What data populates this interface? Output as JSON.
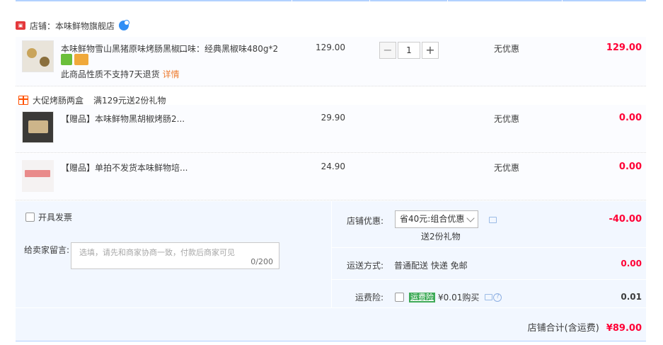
{
  "shop": {
    "name": "店铺：本味鲜物旗舰店",
    "icon": "store-badge-icon",
    "chat_icon": "wangwang-chat-icon"
  },
  "items": [
    {
      "title": "本味鲜物雪山黑猪原味烤肠黑椒...",
      "flavor": "口味：经典黑椒味480g*2",
      "price": "129.00",
      "quantity": "1",
      "discount": "无优惠",
      "total": "129.00",
      "return_note": "此商品性质不支持7天退货",
      "details_link": "详情"
    },
    {
      "title": "【赠品】本味鲜物黑胡椒烤肠2...",
      "price": "29.90",
      "discount": "无优惠",
      "total": "0.00"
    },
    {
      "title": "【赠品】单拍不发货本味鲜物培...",
      "price": "24.90",
      "discount": "无优惠",
      "total": "0.00"
    }
  ],
  "promo": {
    "name": "大促烤肠两盒",
    "description": "满129元送2份礼物"
  },
  "invoice": {
    "label": "开具发票",
    "checked": false
  },
  "message": {
    "label": "给卖家留言:",
    "placeholder": "选填，请先和商家协商一致，付款后商家可见",
    "counter": "0/200"
  },
  "shop_discount": {
    "label": "店铺优惠:",
    "selected": "省40元:组合优惠",
    "gift_note": "送2份礼物",
    "value": "-40.00"
  },
  "shipping": {
    "label": "运送方式:",
    "method": "普通配送 快递 免邮",
    "value": "0.00"
  },
  "insurance": {
    "label": "运费险:",
    "badge": "运费险",
    "price_text": "¥0.01购买",
    "value": "0.01",
    "checked": false
  },
  "summary": {
    "label": "店铺合计(含运费)",
    "amount": "¥89.00"
  },
  "colors": {
    "accent_red": "#ff0036",
    "panel_bg": "#f2f7ff",
    "row_bg": "#fbfcff",
    "link_orange": "#ee7c2f",
    "insurance_green": "#3eaa57"
  }
}
